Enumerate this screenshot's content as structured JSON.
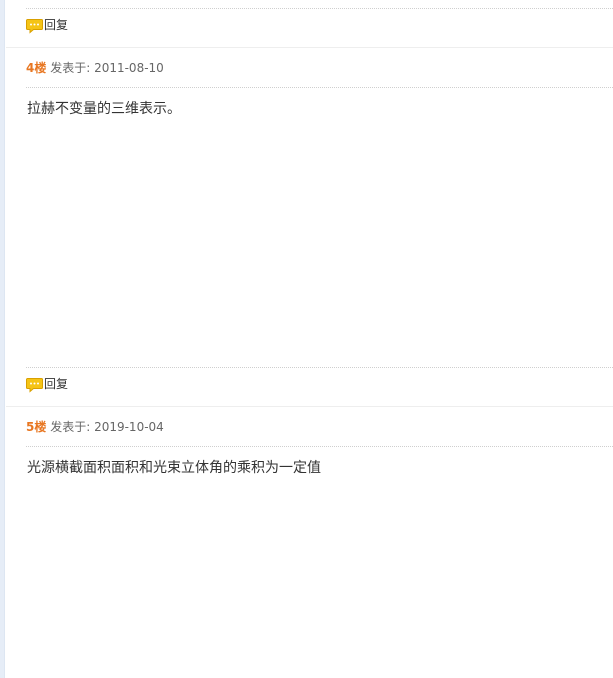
{
  "thread": {
    "reply_label": "回复",
    "posts": [
      {
        "floor": "4楼",
        "posted_label": "发表于:",
        "date": "2011-08-10",
        "content": "拉赫不变量的三维表示。"
      },
      {
        "floor": "5楼",
        "posted_label": "发表于:",
        "date": "2019-10-04",
        "content": "光源横截面积面积和光束立体角的乘积为一定值"
      }
    ]
  },
  "icons": {
    "reply": "speech-bubble-icon"
  },
  "colors": {
    "floor_number": "#e87722",
    "bubble_fill": "#f5c416",
    "bubble_stroke": "#d9a000",
    "text": "#333333",
    "meta": "#666666"
  }
}
